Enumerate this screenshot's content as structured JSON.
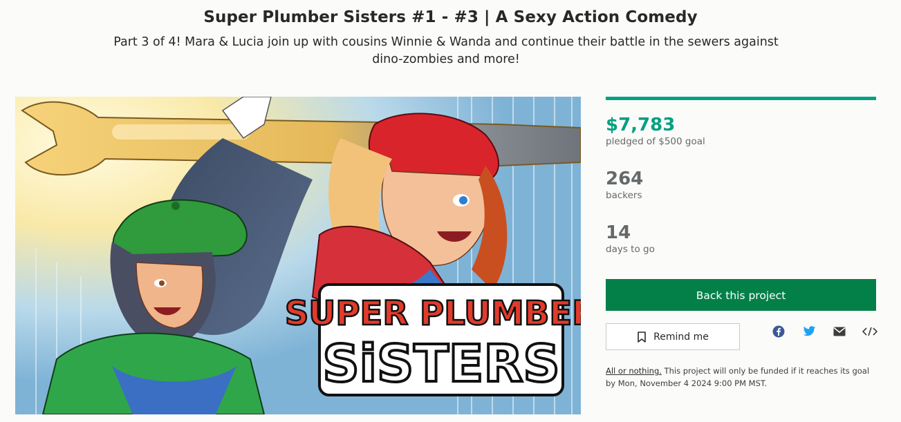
{
  "project": {
    "title": "Super Plumber Sisters #1 - #3 | A Sexy Action Comedy",
    "blurb": "Part 3 of 4! Mara & Lucia join up with cousins Winnie & Wanda and continue their battle in the sewers against dino-zombies and more!"
  },
  "hero_image": {
    "logo_line1": "SUPER PLUMBER",
    "logo_line2": "SiSTERS"
  },
  "funding": {
    "progress_fraction": 1.0,
    "pledged_amount": "$7,783",
    "pledged_label": "pledged of $500 goal",
    "backers_count": "264",
    "backers_label": "backers",
    "days_count": "14",
    "days_label": "days to go"
  },
  "actions": {
    "back_label": "Back this project",
    "remind_label": "Remind me"
  },
  "share_icons": [
    "facebook-icon",
    "twitter-icon",
    "email-icon",
    "embed-icon"
  ],
  "notice": {
    "link_text": "All or nothing.",
    "text": " This project will only be funded if it reaches its goal by Mon, November 4 2024 9:00 PM MST."
  },
  "colors": {
    "accent_green": "#05a081",
    "button_green": "#038048",
    "facebook_blue": "#3b5998",
    "twitter_blue": "#1da1f2"
  }
}
